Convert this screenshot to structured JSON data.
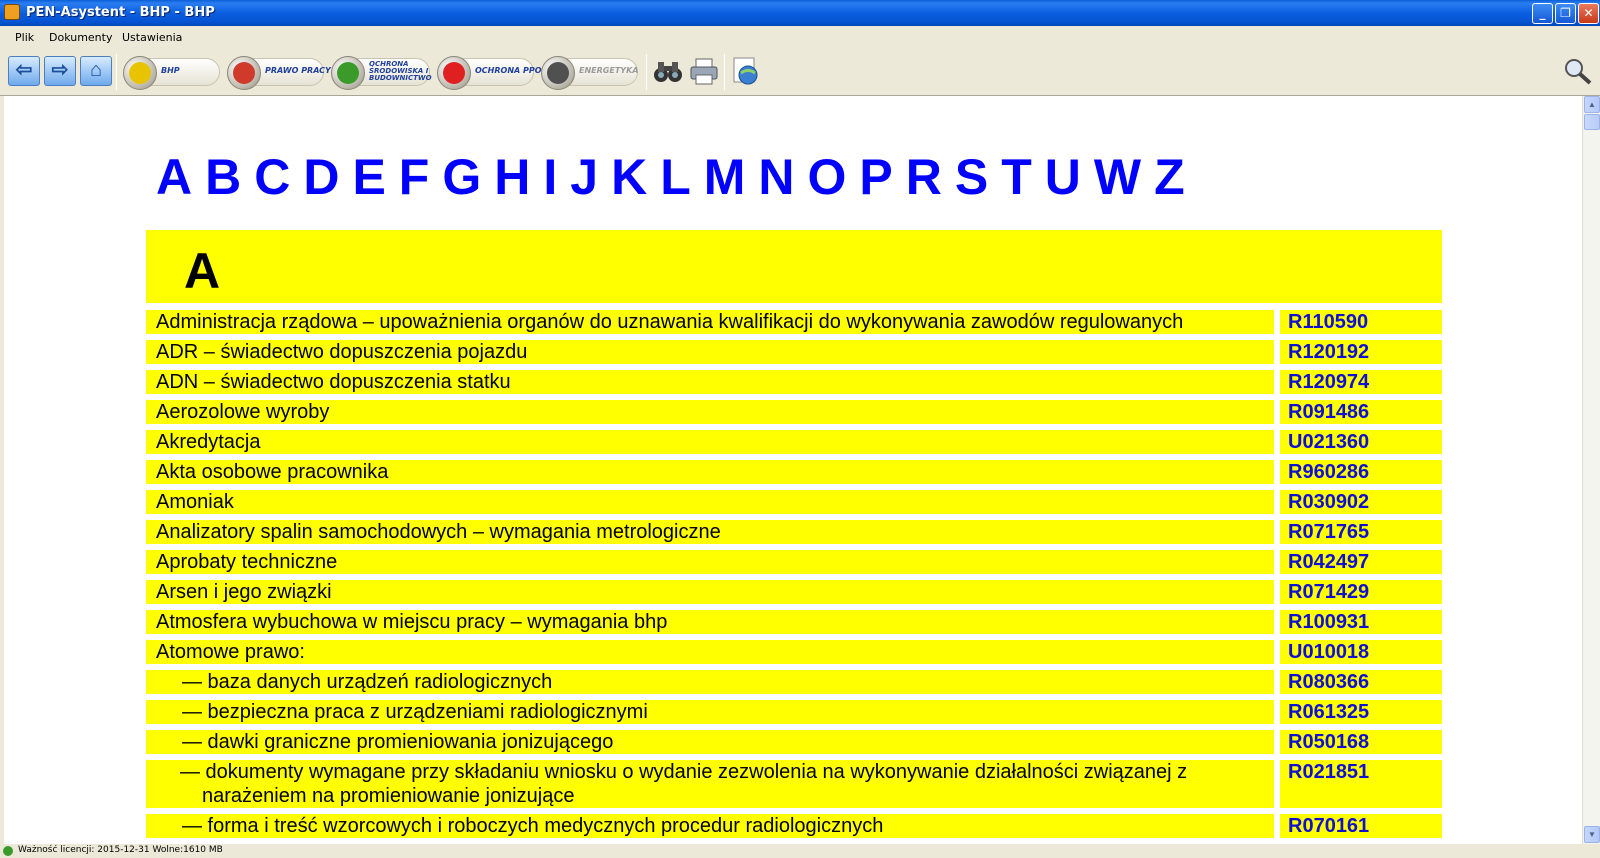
{
  "window": {
    "title": "PEN-Asystent - BHP - BHP",
    "minimize": "_",
    "maximize": "❐",
    "close": "✕"
  },
  "menu": [
    "Plik",
    "Dokumenty",
    "Ustawienia"
  ],
  "toolbar": {
    "back_icon": "back-arrow-icon",
    "forward_icon": "forward-arrow-icon",
    "home_icon": "home-icon",
    "modules": [
      {
        "label": "BHP",
        "color": "#e8c400"
      },
      {
        "label": "PRAWO PRACY",
        "color": "#d03a2a"
      },
      {
        "label": "OCHRONA ŚRODOWISKA I BUDOWNICTWO",
        "color": "#3a9b2a"
      },
      {
        "label": "OCHRONA PPOŻ",
        "color": "#e02020"
      },
      {
        "label": "ENERGETYKA",
        "color": "#505050"
      }
    ],
    "search_icon": "binoculars-icon",
    "print_icon": "printer-icon",
    "globe_icon": "globe-icon",
    "zoom_icon": "magnifier-icon"
  },
  "alphabet": [
    "A",
    "B",
    "C",
    "D",
    "E",
    "F",
    "G",
    "H",
    "I",
    "J",
    "K",
    "L",
    "M",
    "N",
    "O",
    "P",
    "R",
    "S",
    "T",
    "U",
    "W",
    "Z"
  ],
  "section": {
    "letter": "A",
    "rows": [
      {
        "text": "Administracja rządowa – upoważnienia organów do uznawania kwalifikacji do wykonywania zawodów regulowanych",
        "code": "R110590"
      },
      {
        "text": "ADR – świadectwo dopuszczenia pojazdu",
        "code": "R120192"
      },
      {
        "text": "ADN – świadectwo dopuszczenia statku",
        "code": "R120974"
      },
      {
        "text": "Aerozolowe wyroby",
        "code": "R091486"
      },
      {
        "text": "Akredytacja",
        "code": "U021360"
      },
      {
        "text": "Akta osobowe pracownika",
        "code": "R960286"
      },
      {
        "text": "Amoniak",
        "code": "R030902"
      },
      {
        "text": "Analizatory spalin samochodowych – wymagania metrologiczne",
        "code": "R071765"
      },
      {
        "text": "Aprobaty techniczne",
        "code": "R042497"
      },
      {
        "text": "Arsen i jego związki",
        "code": "R071429"
      },
      {
        "text": "Atmosfera wybuchowa w miejscu pracy – wymagania bhp",
        "code": "R100931"
      },
      {
        "text": "Atomowe prawo:",
        "code": "U010018"
      },
      {
        "text": "— baza danych urządzeń radiologicznych",
        "code": "R080366"
      },
      {
        "text": "— bezpieczna praca z urządzeniami radiologicznymi",
        "code": "R061325"
      },
      {
        "text": "— dawki graniczne promieniowania jonizującego",
        "code": "R050168"
      },
      {
        "text": "— dokumenty wymagane przy składaniu wniosku o wydanie zezwolenia na wykonywanie działalności związanej z narażeniem na promieniowanie jonizujące",
        "code": "R021851"
      },
      {
        "text": "— forma i treść wzorcowych i roboczych medycznych procedur radiologicznych",
        "code": "R070161"
      }
    ]
  },
  "status": {
    "text": "Ważność licencji: 2015-12-31   Wolne:1610 MB"
  }
}
